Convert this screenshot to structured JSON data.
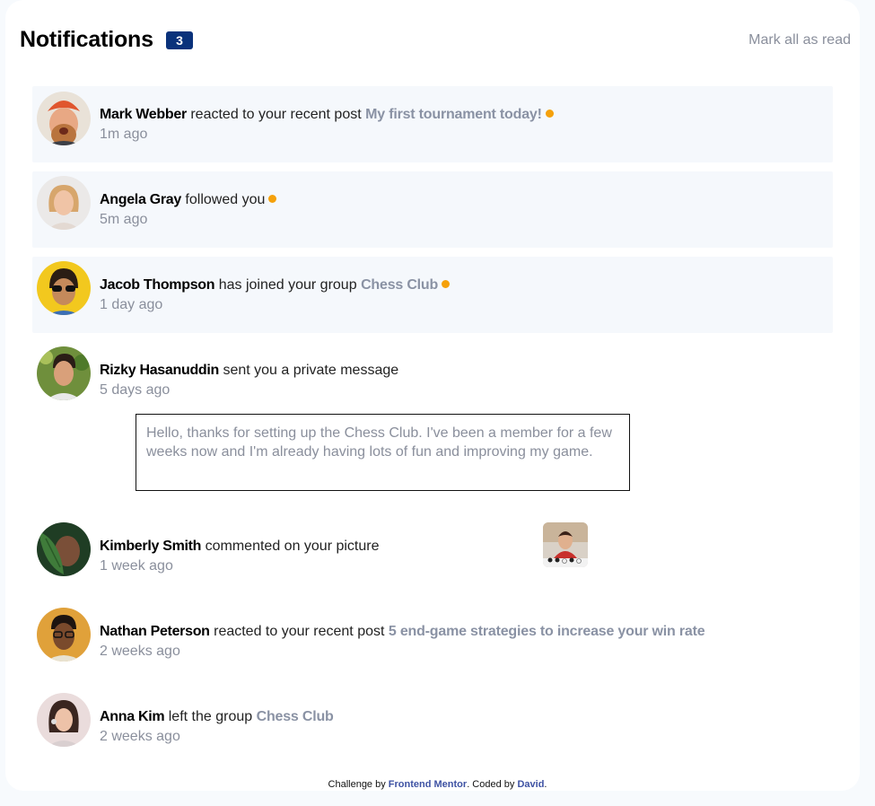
{
  "header": {
    "title": "Notifications",
    "unread_count": "3",
    "mark_all_label": "Mark all as read"
  },
  "notifications": [
    {
      "name": "Mark Webber",
      "action": "reacted to your recent post",
      "target": "My first tournament today!",
      "time": "1m ago",
      "unread": true
    },
    {
      "name": "Angela Gray",
      "action": "followed you",
      "target": "",
      "time": "5m ago",
      "unread": true
    },
    {
      "name": "Jacob Thompson",
      "action": "has joined your group",
      "target": "Chess Club",
      "time": "1 day ago",
      "unread": true
    },
    {
      "name": "Rizky Hasanuddin",
      "action": "sent you a private message",
      "target": "",
      "time": "5 days ago",
      "unread": false,
      "message": "Hello, thanks for setting up the Chess Club. I've been a member for a few weeks now and I'm already having lots of fun and improving my game."
    },
    {
      "name": "Kimberly Smith",
      "action": "commented on your picture",
      "target": "",
      "time": "1 week ago",
      "unread": false
    },
    {
      "name": "Nathan Peterson",
      "action": "reacted to your recent post",
      "target": "5 end-game strategies to increase your win rate",
      "time": "2 weeks ago",
      "unread": false
    },
    {
      "name": "Anna Kim",
      "action": "left the group",
      "target": "Chess Club",
      "time": "2 weeks ago",
      "unread": false
    }
  ],
  "footer": {
    "prefix": "Challenge by",
    "fm_link": "Frontend Mentor",
    "middle": ". Coded by",
    "author_link": "David",
    "suffix": "."
  },
  "colors": {
    "unread_bg": "#f5f8fc",
    "badge": "#0a327b",
    "dot": "#f5a10b",
    "muted": "#8a8f9c"
  }
}
